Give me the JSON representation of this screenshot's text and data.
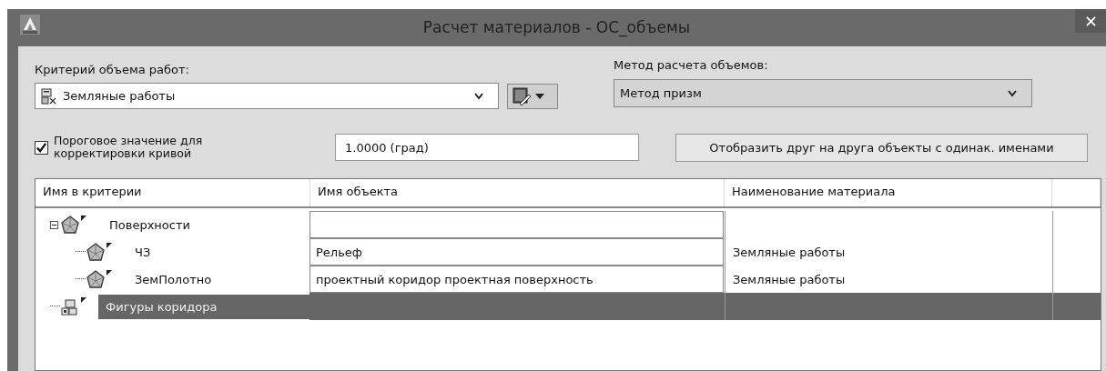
{
  "window": {
    "title": "Расчет материалов - ОС_объемы"
  },
  "criteria": {
    "label": "Критерий объема работ:",
    "value": "Земляные работы"
  },
  "method": {
    "label": "Метод расчета объемов:",
    "value": "Метод призм"
  },
  "threshold": {
    "checked": true,
    "label": "Пороговое значение для корректировки кривой",
    "value": "1.0000 (град)"
  },
  "compare_button": {
    "label": "Отобразить друг на друга объекты с одинак. именами"
  },
  "table": {
    "columns": [
      "Имя в критерии",
      "Имя объекта",
      "Наименование материала"
    ],
    "rows": [
      {
        "name": "Поверхности",
        "kind": "surface",
        "expanded": true,
        "selected": false,
        "children": [
          {
            "name": "ЧЗ",
            "kind": "surface",
            "selected": false,
            "object": "Рельеф",
            "material": "Земляные работы"
          },
          {
            "name": "ЗемПолотно",
            "kind": "surface",
            "selected": false,
            "object": "проектный коридор проектная поверхность",
            "material": "Земляные работы"
          }
        ]
      },
      {
        "name": "Фигуры коридора",
        "kind": "shapes",
        "selected": true
      }
    ]
  }
}
